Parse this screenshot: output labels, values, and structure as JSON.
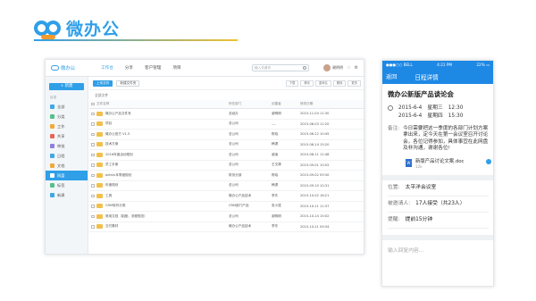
{
  "brand": {
    "name": "微办公"
  },
  "desktop": {
    "logo": "微办公",
    "nav": [
      "工作台",
      "分享",
      "客户管理",
      "项目"
    ],
    "search_placeholder": "输入关键词",
    "user_name": "谢明明",
    "new_button": "+ 新建",
    "side_heading": "目录",
    "side_items": [
      {
        "label": "全部",
        "color": "#3ea8e5"
      },
      {
        "label": "分类",
        "color": "#57c08a"
      },
      {
        "label": "工作",
        "color": "#f0a93c"
      },
      {
        "label": "共享",
        "color": "#e2685a"
      },
      {
        "label": "审批",
        "color": "#8e7ee0"
      },
      {
        "label": "日程",
        "color": "#3ea8e5"
      },
      {
        "label": "文档",
        "color": "#f0a93c"
      },
      {
        "label": "网盘",
        "color": "#ffffff"
      },
      {
        "label": "标签",
        "color": "#57c08a"
      },
      {
        "label": "新建",
        "color": "#3ea8e5"
      }
    ],
    "selected_index": 7,
    "toolbar": {
      "upload": "上传文件",
      "new_folder": "新建文件夹",
      "small": [
        "下载",
        "移动",
        "重命名",
        "删除",
        "更多"
      ]
    },
    "breadcrumb": "全部文件",
    "columns": [
      "文件名称",
      "所在部门",
      "创建者",
      "修改日期"
    ],
    "rows": [
      [
        "微办公产品文件夹",
        "总经办",
        "谢明明",
        "2015-11-04 11:30"
      ],
      [
        "项目",
        "总公司",
        "----",
        "2015-06-03 11:20"
      ],
      [
        "微办公官方 V1.5",
        "总公司",
        "陈晓",
        "2015-06-12 10:45"
      ],
      [
        "技术方案",
        "总公司",
        "韩潇",
        "2015-06-14 15:20"
      ],
      [
        "2016年度活动规划",
        "总公司",
        "谢凌",
        "2015-08-11 11:48"
      ],
      [
        "员工手册",
        "总公司",
        "王文清",
        "2015-09-01 10:02"
      ],
      [
        "admin本季度规划",
        "财务分部",
        "陈晓",
        "2015-09-02 09:30"
      ],
      [
        "年度规划",
        "总公司",
        "韩潇",
        "2015-09-10 10:31"
      ],
      [
        "工具",
        "微办公产品技术",
        "李东",
        "2015-10-02 18:21"
      ],
      [
        "CRM软件分类",
        "CRM部门产品",
        "张小斌",
        "2015-10-11 11:37"
      ],
      [
        "常用文档（制度、流程规范）",
        "总公司",
        "谢明明",
        "2015-10-14 15:02"
      ],
      [
        "交付素材",
        "微办公产品技术",
        "李东",
        "2015-10-21 09:34"
      ]
    ]
  },
  "phone": {
    "status": {
      "carrier": "●●●○○ BELL",
      "time": "4:21 PM",
      "battery": "22% ▭"
    },
    "back": "返回",
    "nav_title": "日程详情",
    "title": "微办公新版产品谈论会",
    "times": [
      {
        "date": "2015-6-4",
        "weekday": "星期三",
        "time": "12:30"
      },
      {
        "date": "2015-6-4",
        "weekday": "星期四",
        "time": "15:30"
      }
    ],
    "note_label": "备注:",
    "note": "今日需要把这一季度的各部门计划方案拿出来，定今天在第一会议室召开讨论会，各位记得参加，具体事宜在此网盘及非沟通，谢谢各位!",
    "attachment": {
      "name": "新版产品讨论文案.doc",
      "size": "12k",
      "ext": "W"
    },
    "fields": [
      {
        "key": "位置:",
        "value": "太平洋会议室"
      },
      {
        "key": "被邀请人:",
        "value": "17人接受（共23人）"
      },
      {
        "key": "提醒:",
        "value": "提前15分钟"
      }
    ],
    "input_placeholder": "输入回复内容..."
  }
}
